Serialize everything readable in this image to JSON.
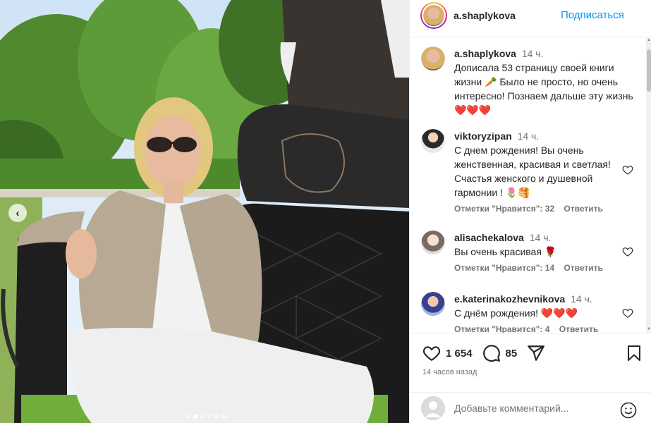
{
  "post": {
    "author": "a.shaplykova",
    "follow_label": "Подписаться",
    "photo_alt": "photo-post",
    "carousel": {
      "current": 2,
      "total": 6
    }
  },
  "caption": {
    "user": "a.shaplykova",
    "time": "14 ч.",
    "text": "Дописала 53 страницу своей книги жизни 🥕 Было не просто, но очень интересно! Познаем дальше эту жизнь ❤️❤️❤️"
  },
  "comments": [
    {
      "user": "viktoryzipan",
      "time": "14 ч.",
      "text": "С днем рождения! Вы очень женственная, красивая и светлая! Счастья женского и душевной гармонии ! 🌷🥞",
      "likes": "Отметки \"Нравится\": 32",
      "reply": "Ответить"
    },
    {
      "user": "alisachekalova",
      "time": "14 ч.",
      "text": "Вы очень красивая 🌹",
      "likes": "Отметки \"Нравится\": 14",
      "reply": "Ответить"
    },
    {
      "user": "e.katerinakozhevnikova",
      "time": "14 ч.",
      "text": "С днём рождения! ❤️❤️❤️",
      "likes": "Отметки \"Нравится\": 4",
      "reply": "Ответить"
    }
  ],
  "actions": {
    "like_count": "1 654",
    "comment_count": "85",
    "posted": "14 часов назад"
  },
  "composer": {
    "placeholder": "Добавьте комментарий..."
  },
  "colors": {
    "link": "#0095f6",
    "muted": "#737373",
    "text": "#262626"
  }
}
